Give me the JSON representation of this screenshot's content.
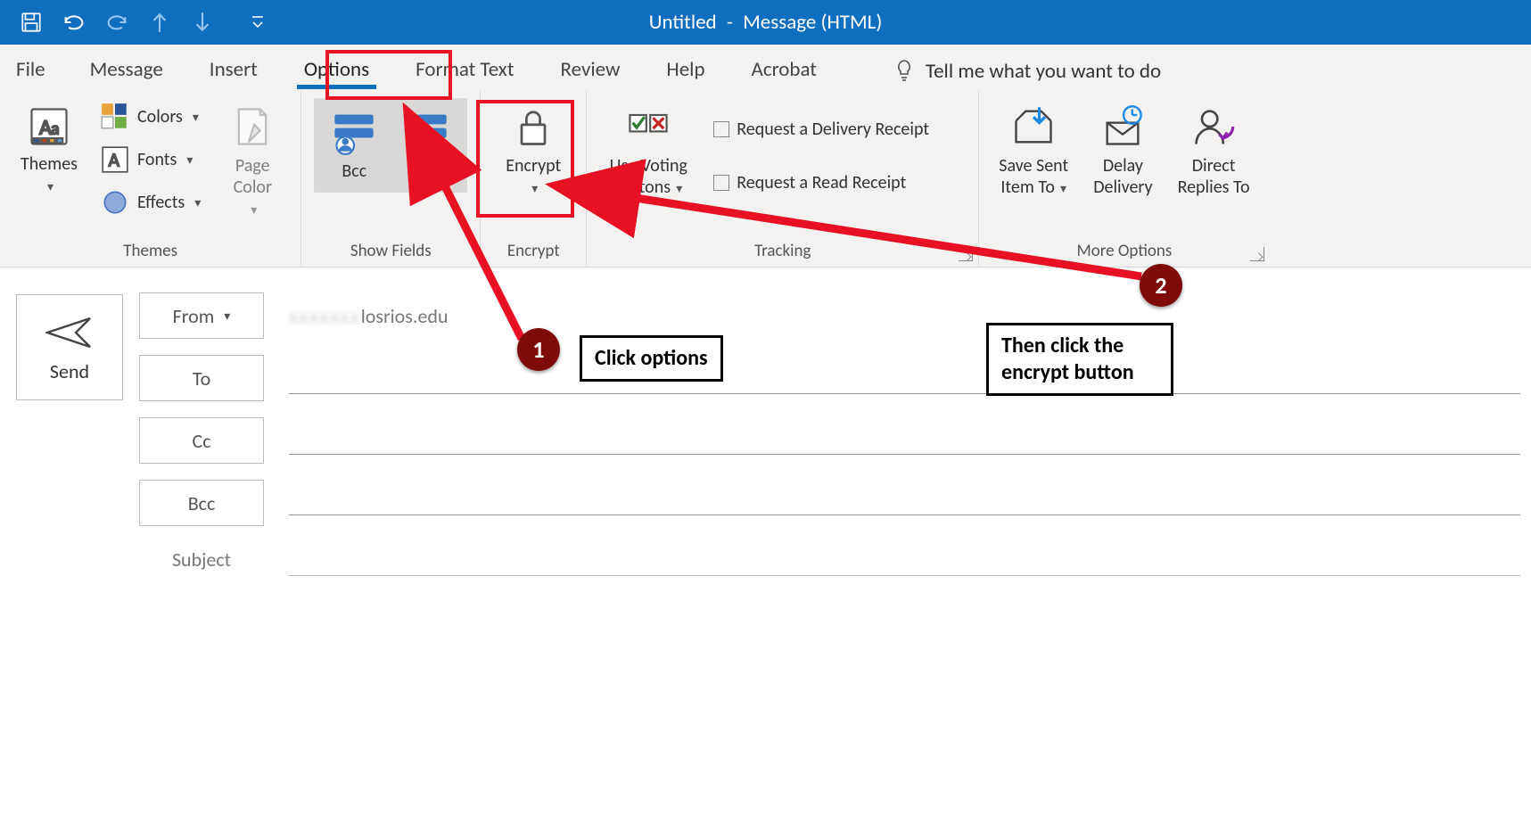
{
  "window": {
    "title_doc": "Untitled",
    "title_type": "Message (HTML)"
  },
  "tabs": {
    "file": "File",
    "message": "Message",
    "insert": "Insert",
    "options": "Options",
    "format_text": "Format Text",
    "review": "Review",
    "help": "Help",
    "acrobat": "Acrobat",
    "tell_me": "Tell me what you want to do"
  },
  "ribbon": {
    "themes": {
      "label": "Themes",
      "themes_btn": "Themes",
      "colors": "Colors",
      "fonts": "Fonts",
      "effects": "Effects",
      "page_color": "Page Color"
    },
    "show_fields": {
      "label": "Show Fields",
      "bcc": "Bcc",
      "from": "From"
    },
    "encrypt": {
      "label": "Encrypt",
      "btn": "Encrypt"
    },
    "tracking": {
      "label": "Tracking",
      "voting_line1": "Use Voting",
      "voting_line2": "Buttons",
      "delivery_receipt": "Request a Delivery Receipt",
      "read_receipt": "Request a Read Receipt"
    },
    "more_options": {
      "label": "More Options",
      "save_sent_line1": "Save Sent",
      "save_sent_line2": "Item To",
      "delay_line1": "Delay",
      "delay_line2": "Delivery",
      "direct_line1": "Direct",
      "direct_line2": "Replies To"
    }
  },
  "compose": {
    "send": "Send",
    "from_btn": "From",
    "from_value_visible": "losrios.edu",
    "to_btn": "To",
    "cc_btn": "Cc",
    "bcc_btn": "Bcc",
    "subject_label": "Subject",
    "to_value": "",
    "cc_value": "",
    "bcc_value": "",
    "subject_value": ""
  },
  "annotations": {
    "step1_num": "1",
    "step1_text": "Click options",
    "step2_num": "2",
    "step2_text": "Then click the encrypt button"
  },
  "colors": {
    "accent": "#106EBE",
    "annotation_red": "#E81123",
    "callout_fill": "#7E0A0A"
  }
}
